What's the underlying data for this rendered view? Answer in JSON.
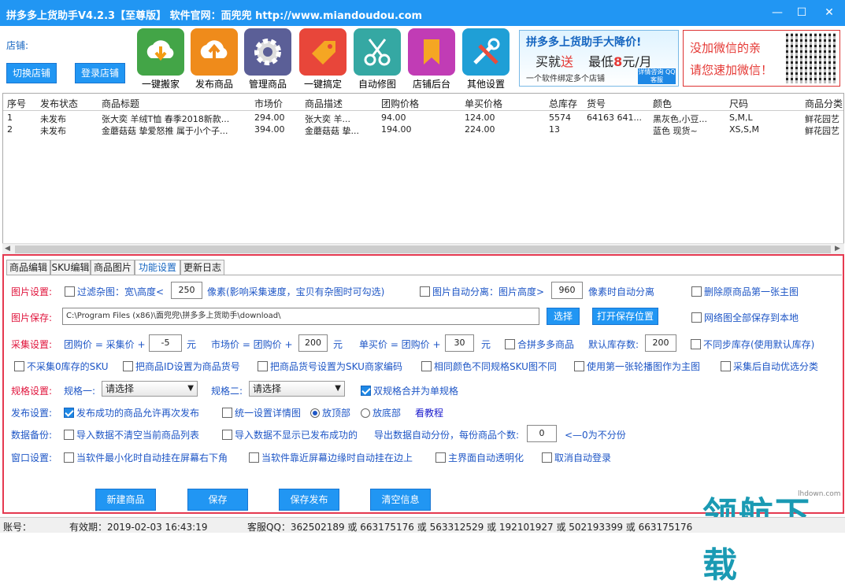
{
  "window": {
    "title": "拼多多上货助手V4.2.3【至尊版】   软件官网：面兜兜 http://www.miandoudou.com",
    "minimize": "—",
    "maximize": "☐",
    "close": "✕"
  },
  "store": {
    "label": "店铺:",
    "switch_label": "切换店铺",
    "login_label": "登录店铺"
  },
  "tools": [
    {
      "label": "一键搬家",
      "icon": "download-cloud-icon",
      "color": "#43a547"
    },
    {
      "label": "发布商品",
      "icon": "upload-cloud-icon",
      "color": "#ef8b1b"
    },
    {
      "label": "管理商品",
      "icon": "gear-icon",
      "color": "#5b5f97"
    },
    {
      "label": "一键搞定",
      "icon": "tag-icon",
      "color": "#e8463a"
    },
    {
      "label": "自动修图",
      "icon": "scissors-icon",
      "color": "#35a8a3"
    },
    {
      "label": "店铺后台",
      "icon": "bookmark-icon",
      "color": "#c13cb5"
    },
    {
      "label": "其他设置",
      "icon": "tools-icon",
      "color": "#1f9fd6"
    }
  ],
  "banner1": {
    "line1": "拼多多上货助手大降价!",
    "line2a": "买就",
    "line2b": "送",
    "line2c": "最低",
    "line2d": "8",
    "line2e": "元/月",
    "line3": "一个软件绑定多个店铺",
    "line3b": "详情咨询 QQ客服"
  },
  "banner2": {
    "line1": "没加微信的亲",
    "line2": "请您速加微信！"
  },
  "table": {
    "headers": [
      "序号",
      "发布状态",
      "商品标题",
      "市场价",
      "商品描述",
      "团购价格",
      "单买价格",
      "总库存",
      "货号",
      "颜色",
      "尺码",
      "商品分类"
    ],
    "rows": [
      [
        "1",
        "未发布",
        "张大奕  羊绒T恤 春季2018新款...",
        "294.00",
        "张大奕   羊...",
        "94.00",
        "124.00",
        "5574",
        "64163 641...",
        "黑灰色,小豆...",
        "S,M,L",
        "鲜花园艺"
      ],
      [
        "2",
        "未发布",
        "金蘑菇菇 挚爱怒推 属于小个子...",
        "394.00",
        "金蘑菇菇 挚...",
        "194.00",
        "224.00",
        "13",
        "",
        "蓝色 现货~",
        "XS,S,M",
        "鲜花园艺"
      ]
    ]
  },
  "tabs": [
    "商品编辑",
    "SKU编辑",
    "商品图片",
    "功能设置",
    "更新日志"
  ],
  "settings": {
    "pic": {
      "label": "图片设置:",
      "filter": "过滤杂图：宽\\高度<",
      "filter_val": "250",
      "filter_tail": "像素(影响采集速度，宝贝有杂图时可勾选)",
      "split": "图片自动分离：图片高度>",
      "split_val": "960",
      "split_tail": "像素时自动分离",
      "delete_first": "删除原商品第一张主图"
    },
    "save": {
      "label": "图片保存:",
      "path": "C:\\Program Files (x86)\\面兜兜\\拼多多上货助手\\download\\",
      "choose": "选择",
      "open": "打开保存位置",
      "netpic": "网络图全部保存到本地"
    },
    "collect": {
      "label": "采集设置:",
      "group": "团购价 = 采集价 +",
      "group_val": "-5",
      "unit1": "元",
      "market": "市场价 = 团购价 +",
      "market_val": "200",
      "unit2": "元",
      "single": "单买价 = 团购价 +",
      "single_val": "30",
      "unit3": "元",
      "multi": "合拼多多商品",
      "stock": "默认库存数:",
      "stock_val": "200",
      "nosync": "不同步库存(使用默认库存)"
    },
    "row4": [
      "不采集0库存的SKU",
      "把商品ID设置为商品货号",
      "把商品货号设置为SKU商家编码",
      "相同颜色不同规格SKU图不同",
      "使用第一张轮播图作为主图",
      "采集后自动优选分类"
    ],
    "spec": {
      "label": "规格设置:",
      "spec1": "规格一:",
      "spec1_val": "请选择",
      "spec2": "规格二:",
      "spec2_val": "请选择",
      "merge": "双规格合并为单规格"
    },
    "publish": {
      "label": "发布设置:",
      "again": "发布成功的商品允许再次发布",
      "detail": "统一设置详情图",
      "top": "放顶部",
      "bottom": "放底部",
      "tutorial": "看教程"
    },
    "backup": {
      "label": "数据备份:",
      "noclear": "导入数据不清空当前商品列表",
      "nohide": "导入数据不显示已发布成功的",
      "export": "导出数据自动分份，每份商品个数:",
      "export_val": "0",
      "hint": "<—0为不分份"
    },
    "window": {
      "label": "窗口设置:",
      "min": "当软件最小化时自动挂在屏幕右下角",
      "edge": "当软件靠近屏幕边缘时自动挂在边上",
      "transparent": "主界面自动透明化",
      "nologin": "取消自动登录"
    }
  },
  "buttons": {
    "new": "新建商品",
    "save": "保存",
    "save_publish": "保存发布",
    "clear": "清空信息"
  },
  "status": {
    "account": "账号：",
    "expiry": "有效期：2019-02-03 16:43:19",
    "qq": "客服QQ：362502189 或 663175176 或 563312529 或 192101927 或 502193399 或 663175176"
  },
  "watermark": {
    "big": "领航下载",
    "small": "lhdown.com"
  }
}
